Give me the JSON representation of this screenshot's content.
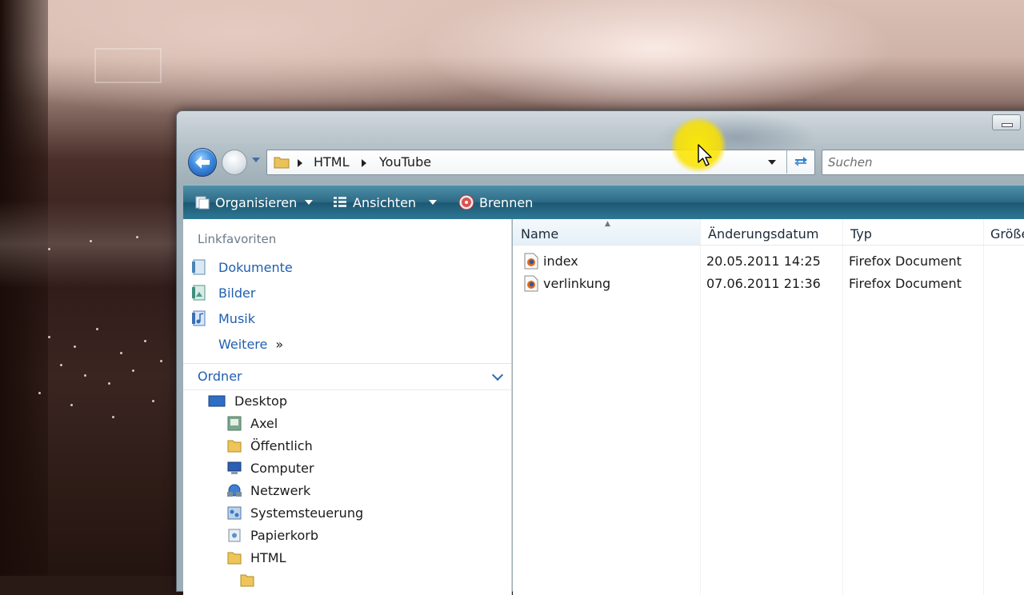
{
  "window": {
    "address": {
      "crumbs": [
        "HTML",
        "YouTube"
      ]
    },
    "search": {
      "placeholder": "Suchen"
    },
    "toolbar": {
      "organize": "Organisieren",
      "views": "Ansichten",
      "burn": "Brennen"
    },
    "nav_pane": {
      "favorites_title": "Linkfavoriten",
      "favorites": [
        {
          "label": "Dokumente",
          "icon": "documents-icon"
        },
        {
          "label": "Bilder",
          "icon": "pictures-icon"
        },
        {
          "label": "Musik",
          "icon": "music-icon"
        }
      ],
      "more_label": "Weitere",
      "more_glyph": "»",
      "folders_title": "Ordner",
      "tree": [
        {
          "label": "Desktop",
          "icon": "desktop-icon"
        },
        {
          "label": "Axel",
          "icon": "user-folder-icon"
        },
        {
          "label": "Öffentlich",
          "icon": "folder-icon"
        },
        {
          "label": "Computer",
          "icon": "computer-icon"
        },
        {
          "label": "Netzwerk",
          "icon": "network-icon"
        },
        {
          "label": "Systemsteuerung",
          "icon": "control-panel-icon"
        },
        {
          "label": "Papierkorb",
          "icon": "recycle-bin-icon"
        },
        {
          "label": "HTML",
          "icon": "folder-icon"
        }
      ]
    },
    "content_pane": {
      "columns": [
        "Name",
        "Änderungsdatum",
        "Typ",
        "Größe"
      ],
      "files": [
        {
          "name": "index",
          "modified": "20.05.2011 14:25",
          "type": "Firefox Document"
        },
        {
          "name": "verlinkung",
          "modified": "07.06.2011 21:36",
          "type": "Firefox Document"
        }
      ]
    }
  },
  "colors": {
    "toolbar": "#2d6b86",
    "link_blue": "#1f5fb0",
    "cursor_highlight": "#f5e000"
  }
}
